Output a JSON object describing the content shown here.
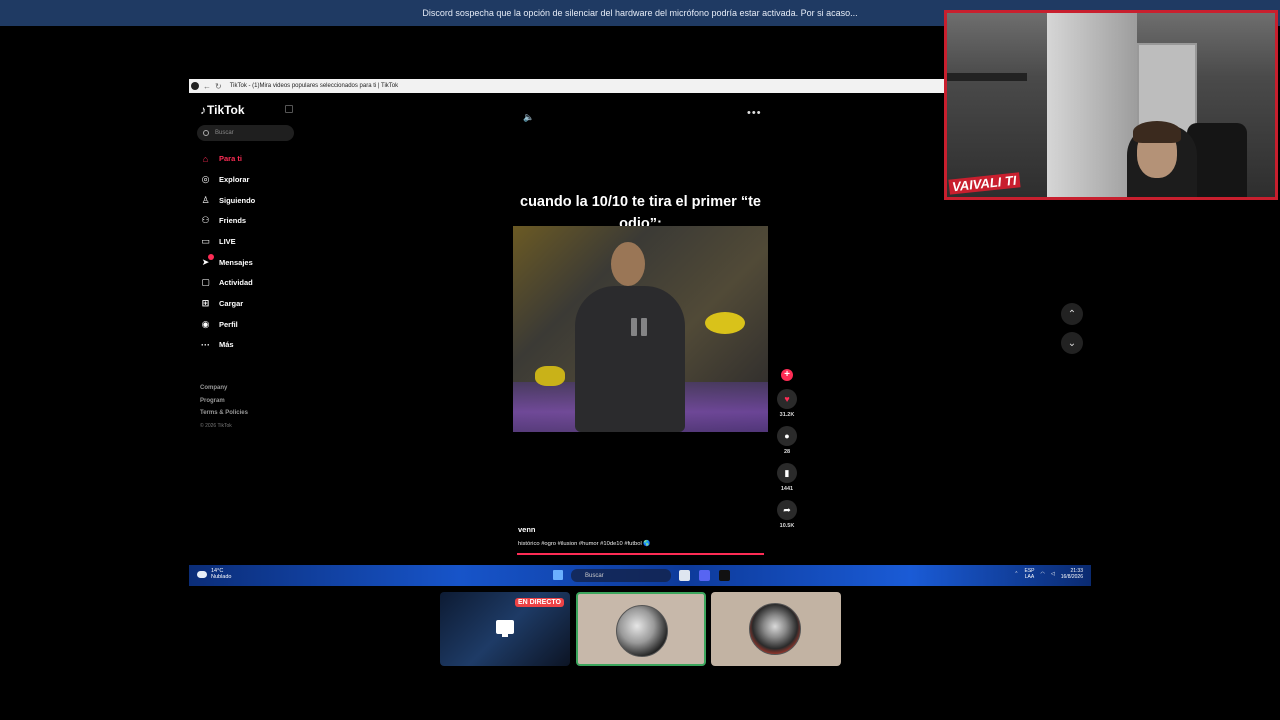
{
  "banner": {
    "text": "Discord sospecha que la opción de silenciar del hardware del micrófono podría estar activada. Por si acaso..."
  },
  "browser": {
    "tab_title": "TikTok - (1)Mira videos populares seleccionados para ti | TikTok"
  },
  "tiktok": {
    "logo": "TikTok",
    "search_placeholder": "Buscar",
    "menu": [
      {
        "label": "Para ti",
        "icon": "home-icon"
      },
      {
        "label": "Explorar",
        "icon": "compass-icon"
      },
      {
        "label": "Siguiendo",
        "icon": "following-icon"
      },
      {
        "label": "Friends",
        "icon": "friends-icon"
      },
      {
        "label": "LIVE",
        "icon": "live-icon"
      },
      {
        "label": "Mensajes",
        "icon": "messages-icon"
      },
      {
        "label": "Actividad",
        "icon": "activity-icon"
      },
      {
        "label": "Cargar",
        "icon": "upload-icon"
      },
      {
        "label": "Perfil",
        "icon": "profile-avatar-icon"
      },
      {
        "label": "Más",
        "icon": "more-dots-icon"
      }
    ],
    "footer": {
      "company": "Company",
      "program": "Program",
      "terms": "Terms & Policies",
      "copyright": "© 2026 TikTok"
    },
    "video": {
      "caption": "cuando la 10/10 te tira el primer “te odio”:",
      "username": "venn",
      "hashtags": "histórico #ogro #ilusion #humor #10de10 #futbol 🌎",
      "likes": "31.2K",
      "comments": "28",
      "saves": "1441",
      "shares": "10.5K"
    }
  },
  "taskbar": {
    "weather_temp": "14°C",
    "weather_desc": "Nublado",
    "search_placeholder": "Buscar",
    "lang_top": "ESP",
    "lang_bottom": "LAA",
    "time": "21:33",
    "date": "16/8/2026"
  },
  "discord": {
    "live_badge": "EN DIRECTO"
  },
  "webcam": {
    "logo_text": "VAIVALI TI"
  }
}
